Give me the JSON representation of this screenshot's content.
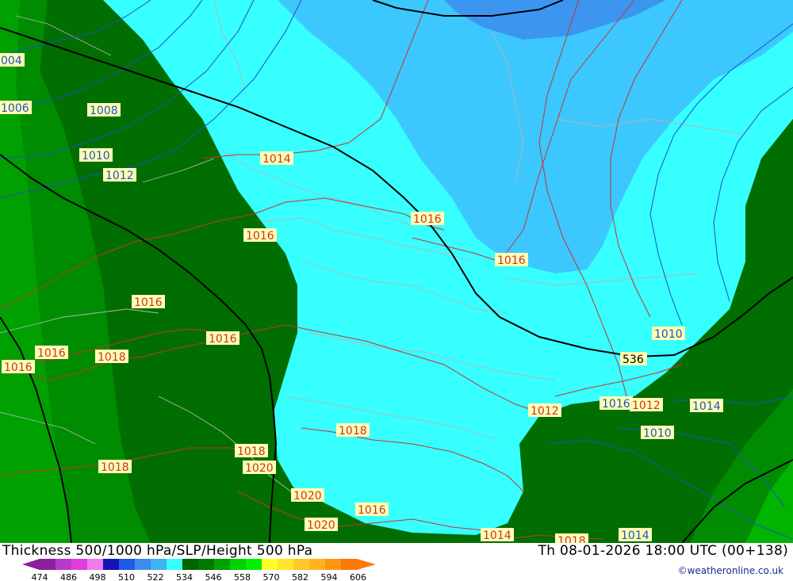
{
  "title": "Thickness 500/1000 hPa/SLP/Height 500 hPa",
  "valid_time": "Th 08-01-2026 18:00 UTC (00+138)",
  "credit": "©weatheronline.co.uk",
  "legend": {
    "ticks": [
      "474",
      "486",
      "498",
      "510",
      "522",
      "534",
      "546",
      "558",
      "570",
      "582",
      "594",
      "606"
    ],
    "colors": [
      "#8c1f9c",
      "#b43cc8",
      "#e03ce0",
      "#f07af0",
      "#1414b4",
      "#1e5ae6",
      "#3c8cf0",
      "#3cb4f0",
      "#37ffff",
      "#006400",
      "#007800",
      "#00a000",
      "#00d200",
      "#00f000",
      "#ffff28",
      "#ffe628",
      "#ffc828",
      "#ffb41e",
      "#ff9614",
      "#ff780a"
    ]
  },
  "map": {
    "isobar_labels": [
      "004",
      "1006",
      "1008",
      "1010",
      "1012",
      "1014",
      "1016",
      "1016",
      "1016",
      "1016",
      "1016",
      "1016",
      "1016",
      "1018",
      "1018",
      "1018",
      "1020",
      "1020",
      "1018",
      "1016",
      "1020",
      "1014",
      "1018",
      "1014",
      "1012",
      "1016",
      "1012",
      "1014",
      "1010",
      "1010",
      "1012",
      "1020"
    ],
    "thickness_label": "536",
    "colors": {
      "dark_green": "#006e00",
      "green": "#008200",
      "light_green": "#00a000",
      "cyan": "#37ffff",
      "light_blue": "#3cc8ff",
      "blue": "#3c96f0",
      "isobar": "#c83232",
      "slp_blue": "#1e50c8",
      "border": "#a0a0a0",
      "height": "#000000"
    }
  }
}
